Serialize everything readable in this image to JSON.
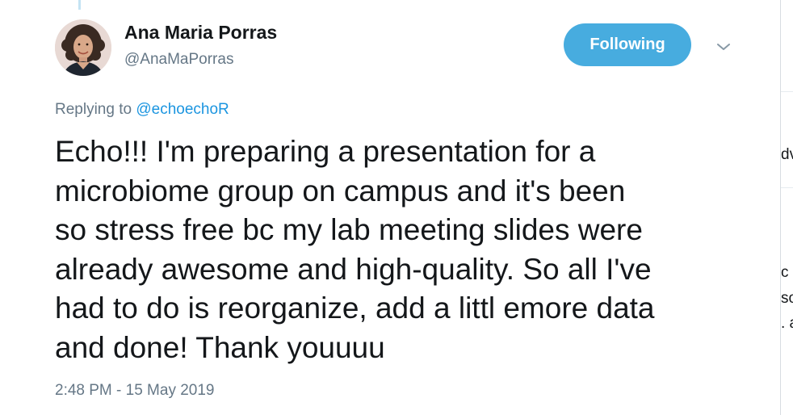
{
  "tweet": {
    "display_name": "Ana Maria Porras",
    "handle": "@AnaMaPorras",
    "follow_label": "Following",
    "replying_prefix": "Replying to ",
    "replying_to": "@echoechoR",
    "text": "Echo!!! I'm preparing a presentation for a\nmicrobiome group on campus and it's been\nso stress free bc my lab meeting slides were\nalready awesome and high-quality. So all I've\nhad to do is reorganize, add a littl emore data\nand done! Thank youuuu",
    "timestamp": "2:48 PM - 15 May 2019"
  },
  "background_fragments": [
    "dv",
    "c",
    "so",
    ". a"
  ],
  "colors": {
    "accent": "#47acdf",
    "mention": "#1b95e0",
    "secondary_text": "#657786",
    "primary_text": "#14171a"
  },
  "icons": {
    "menu": "chevron-down-icon",
    "avatar": "profile-photo"
  }
}
